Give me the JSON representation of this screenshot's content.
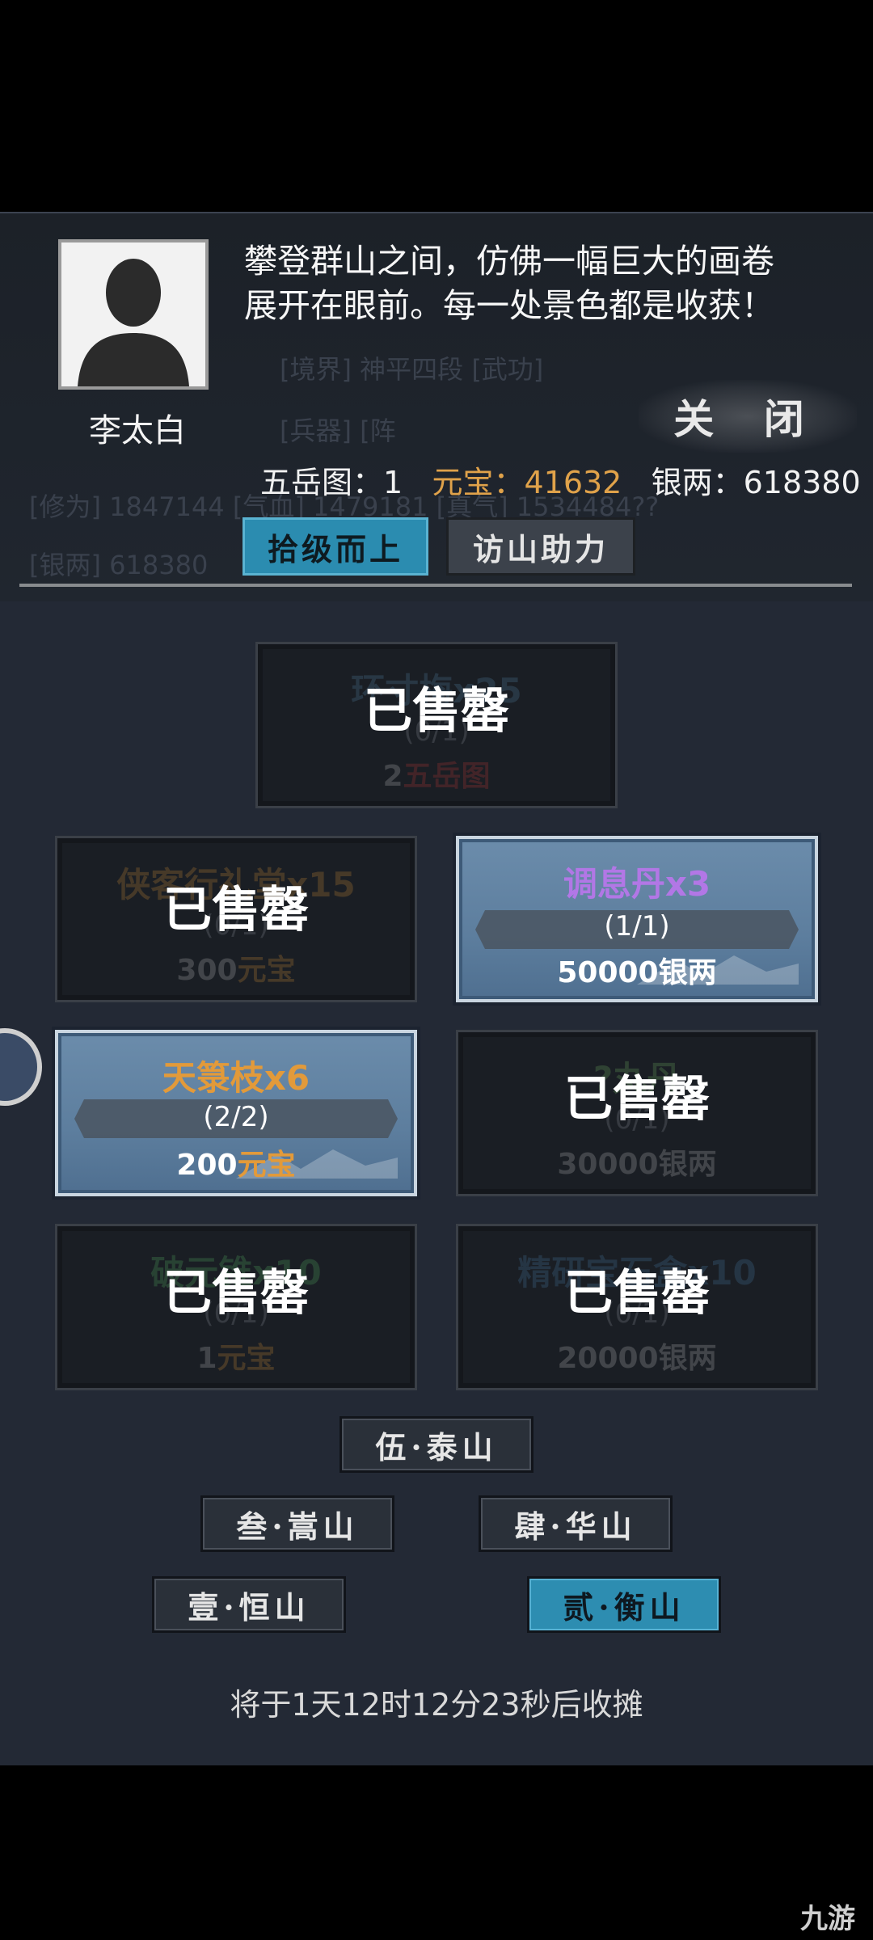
{
  "character": {
    "name": "李太白"
  },
  "dialog": {
    "line1": "攀登群山之间，仿佛一幅巨大的画卷",
    "line2": "展开在眼前。每一处景色都是收获！"
  },
  "close_button": "关 闭",
  "resources": {
    "map_label": "五岳图：",
    "map_value": "1",
    "yuanbao_label": "元宝：",
    "yuanbao_value": "41632",
    "silver_label": "银两：",
    "silver_value": "618380"
  },
  "tabs": [
    "拾级而上",
    "访山助力"
  ],
  "background_text": {
    "row1": "[境界] 神平四段    [武功]",
    "row2": "[兵器]           [阵",
    "row3": "[修为] 1847144    [气血] 1479181    [真气] 1534484??",
    "row4": "[银两] 618380"
  },
  "shop": {
    "sold_label": "已售罄",
    "items": [
      {
        "title": "环寸梅x25",
        "count": "(0/1)",
        "price_num": "2",
        "price_unit": "五岳图",
        "sold": true
      },
      {
        "title": "侠客行礼堂x15",
        "count": "(0/1)",
        "price_num": "300",
        "price_unit": "元宝",
        "sold": true
      },
      {
        "title": "调息丹x3",
        "count": "(1/1)",
        "price_num": "50000",
        "price_unit": "银两",
        "sold": false
      },
      {
        "title": "天箓枝x6",
        "count": "(2/2)",
        "price_num": "200",
        "price_unit": "元宝",
        "sold": false
      },
      {
        "title": "?丸丹",
        "count": "(0/1)",
        "price_num": "30000",
        "price_unit": "银两",
        "sold": true
      },
      {
        "title": "破元锥x10",
        "count": "(0/1)",
        "price_num": "1",
        "price_unit": "元宝",
        "sold": true
      },
      {
        "title": "精研宝石盒x10",
        "count": "(0/1)",
        "price_num": "20000",
        "price_unit": "银两",
        "sold": true
      }
    ]
  },
  "mountains": [
    "伍·泰山",
    "叁·嵩山",
    "肆·华山",
    "壹·恒山",
    "贰·衡山"
  ],
  "timer": "将于1天12时12分23秒后收摊",
  "watermark": "九游",
  "colors": {
    "accent": "#2b8cb0",
    "gold": "#e0a24a",
    "purple": "#b277e6",
    "panel": "#232935"
  }
}
